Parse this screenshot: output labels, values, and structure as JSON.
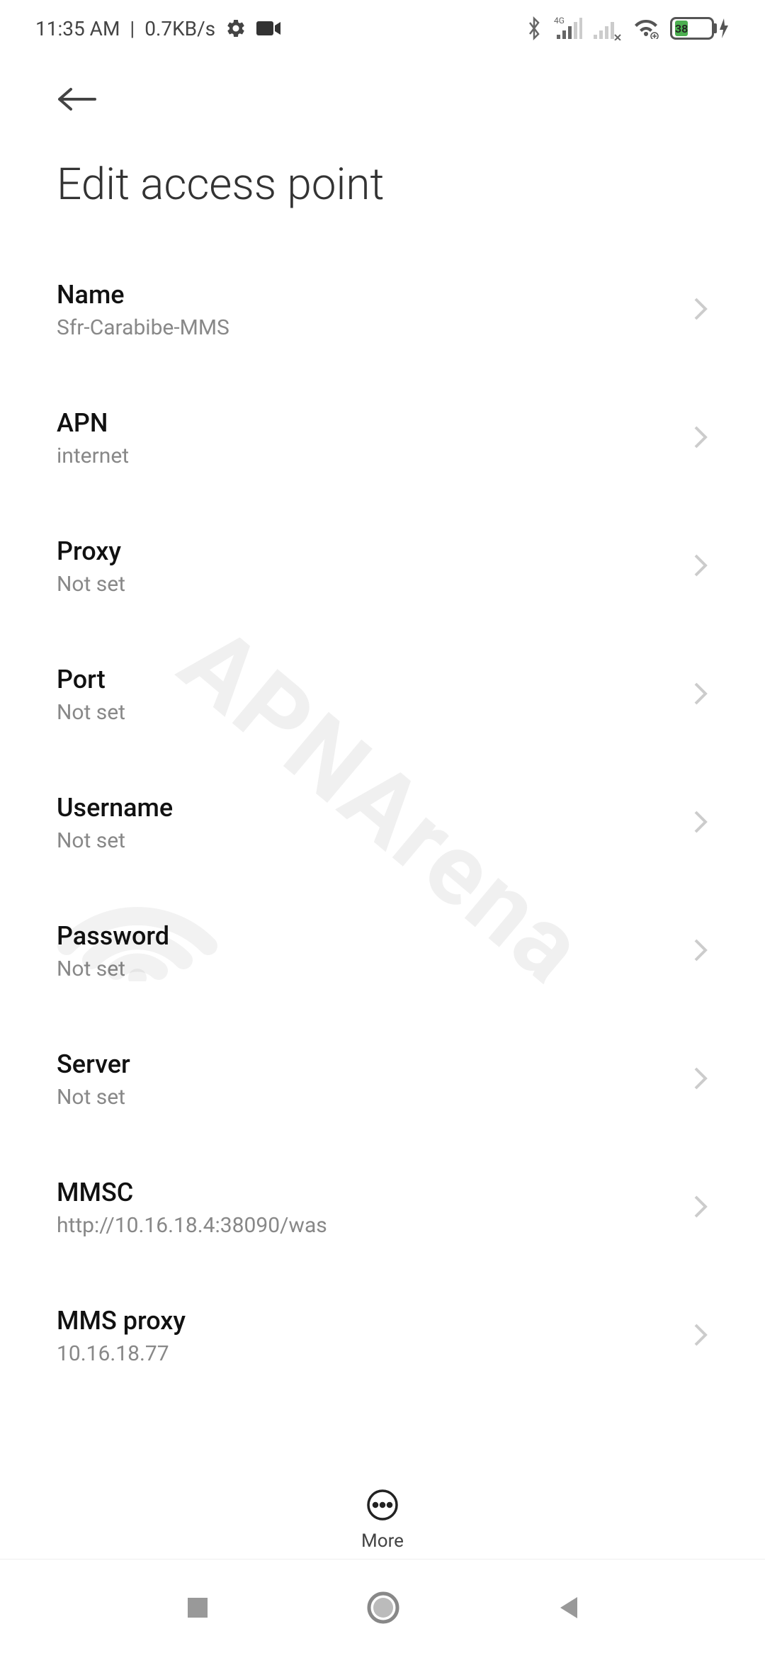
{
  "statusBar": {
    "time": "11:35 AM",
    "speed": "0.7KB/s",
    "battery": "38"
  },
  "header": {
    "title": "Edit access point"
  },
  "items": [
    {
      "title": "Name",
      "sub": "Sfr-Carabibe-MMS"
    },
    {
      "title": "APN",
      "sub": "internet"
    },
    {
      "title": "Proxy",
      "sub": "Not set"
    },
    {
      "title": "Port",
      "sub": "Not set"
    },
    {
      "title": "Username",
      "sub": "Not set"
    },
    {
      "title": "Password",
      "sub": "Not set"
    },
    {
      "title": "Server",
      "sub": "Not set"
    },
    {
      "title": "MMSC",
      "sub": "http://10.16.18.4:38090/was"
    },
    {
      "title": "MMS proxy",
      "sub": "10.16.18.77"
    }
  ],
  "bottom": {
    "more": "More"
  },
  "watermark": "APNArena"
}
